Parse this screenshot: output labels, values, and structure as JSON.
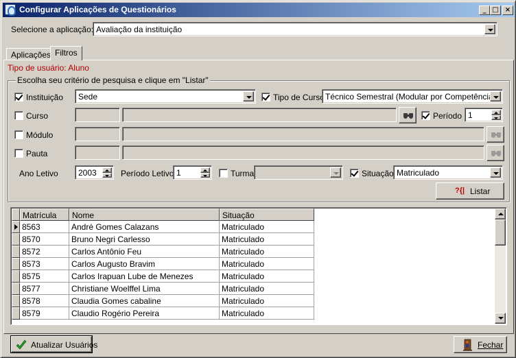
{
  "window": {
    "title": "Configurar Aplicações de Questionários",
    "minimize_glyph": "_",
    "maximize_glyph": "□",
    "close_glyph": "×"
  },
  "app_select": {
    "label": "Selecione a aplicação:",
    "value": "Avaliação da instituição"
  },
  "tabs": [
    {
      "label": "Aplicações",
      "active": false
    },
    {
      "label": "Filtros",
      "active": true
    }
  ],
  "user_type": "Tipo de usuário: Aluno",
  "filters": {
    "group_caption": "Escolha seu critério de pesquisa e clique em \"Listar\"",
    "instituicao": {
      "label": "Instituição",
      "checked": true,
      "value": "Sede"
    },
    "tipo_curso": {
      "label": "Tipo de Curso",
      "checked": true,
      "value": "Técnico Semestral (Modular por Competência)"
    },
    "curso": {
      "label": "Curso",
      "checked": false,
      "code": "",
      "name": ""
    },
    "periodo": {
      "label": "Período",
      "checked": true,
      "value": "1"
    },
    "modulo": {
      "label": "Módulo",
      "checked": false
    },
    "pauta": {
      "label": "Pauta",
      "checked": false
    },
    "ano_letivo": {
      "label": "Ano Letivo",
      "value": "2003"
    },
    "periodo_letivo": {
      "label": "Período Letivo",
      "value": "1"
    },
    "turma": {
      "label": "Turma",
      "checked": false,
      "value": ""
    },
    "situacao": {
      "label": "Situação",
      "checked": true,
      "value": "Matriculado"
    },
    "listar_button": "Listar",
    "listar_icon_text": "?{|"
  },
  "grid": {
    "columns": [
      "Matrícula",
      "Nome",
      "Situação"
    ],
    "rows": [
      {
        "matricula": "8563",
        "nome": "André Gomes Calazans",
        "situacao": "Matriculado"
      },
      {
        "matricula": "8570",
        "nome": "Bruno Negri Carlesso",
        "situacao": "Matriculado"
      },
      {
        "matricula": "8572",
        "nome": "Carlos Antônio Feu",
        "situacao": "Matriculado"
      },
      {
        "matricula": "8573",
        "nome": "Carlos Augusto Bravim",
        "situacao": "Matriculado"
      },
      {
        "matricula": "8575",
        "nome": "Carlos Irapuan Lube de Menezes",
        "situacao": "Matriculado"
      },
      {
        "matricula": "8577",
        "nome": "Christiane Woelffel Lima",
        "situacao": "Matriculado"
      },
      {
        "matricula": "8578",
        "nome": "Claudia Gomes cabaline",
        "situacao": "Matriculado"
      },
      {
        "matricula": "8579",
        "nome": "Claudio Rogério Pereira",
        "situacao": "Matriculado"
      }
    ]
  },
  "footer": {
    "update_button": "Atualizar Usuários",
    "close_button": "Fechar"
  },
  "colors": {
    "title_gradient_start": "#0a246a",
    "title_gradient_end": "#a6caf0",
    "user_type_text": "#b00000",
    "face": "#d4d0c8"
  }
}
